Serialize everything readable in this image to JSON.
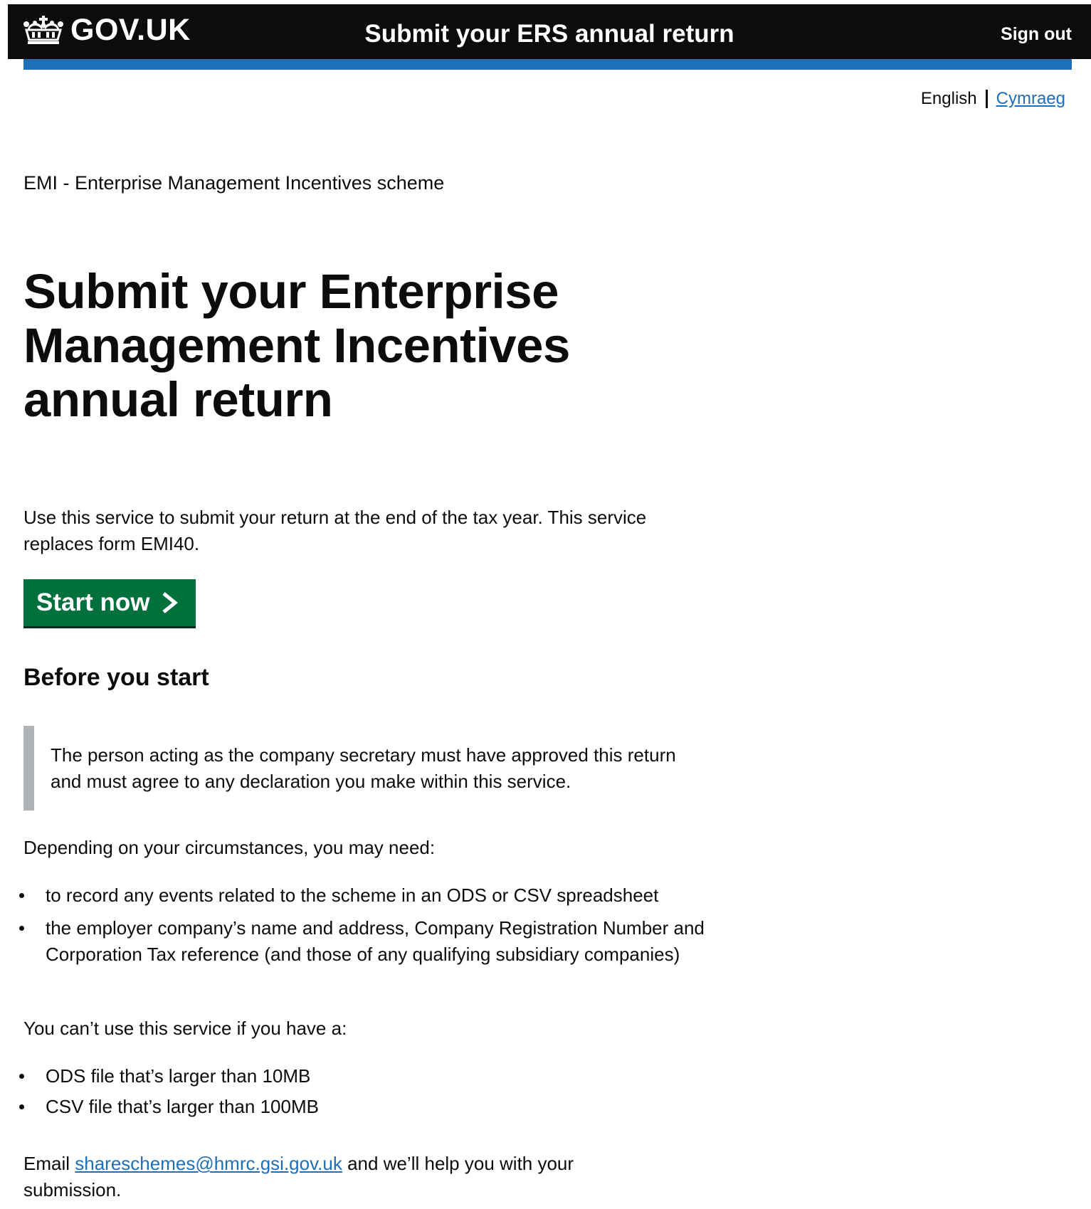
{
  "header": {
    "logo_text": "GOV.UK",
    "service_name": "Submit your ERS annual return",
    "sign_out_label": "Sign out"
  },
  "language": {
    "current": "English",
    "alternate": "Cymraeg"
  },
  "main": {
    "caption": "EMI - Enterprise Management Incentives scheme",
    "title": "Submit your Enterprise Management Incentives annual return",
    "intro": "Use this service to submit your return at the end of the tax year. This service replaces form EMI40.",
    "start_button_label": "Start now",
    "before_heading": "Before you start",
    "inset_text": "The person acting as the company secretary must have approved this return and must agree to any declaration you make within this service.",
    "may_need_intro": "Depending on your circumstances, you may need:",
    "may_need_items": [
      "to record any events related to the scheme in an ODS or CSV spreadsheet",
      "the employer company’s name and address, Company Registration Number and Corporation Tax reference (and those of any qualifying subsidiary companies)"
    ],
    "cannot_use_intro": "You can’t use this service if you have a:",
    "cannot_use_items": [
      "ODS file that’s larger than 10MB",
      "CSV file that’s larger than 100MB"
    ],
    "email_prefix": "Email",
    "email_link": "shareschemes@hmrc.gsi.gov.uk",
    "email_suffix": "and we’ll help you with your submission."
  },
  "colors": {
    "header_bg": "#0b0c0c",
    "brand_blue": "#1d70b8",
    "start_button": "#00703c",
    "inset_border": "#b1b4b6"
  },
  "icons": {
    "logo": "crown-icon",
    "start_button": "chevron-right-icon"
  }
}
